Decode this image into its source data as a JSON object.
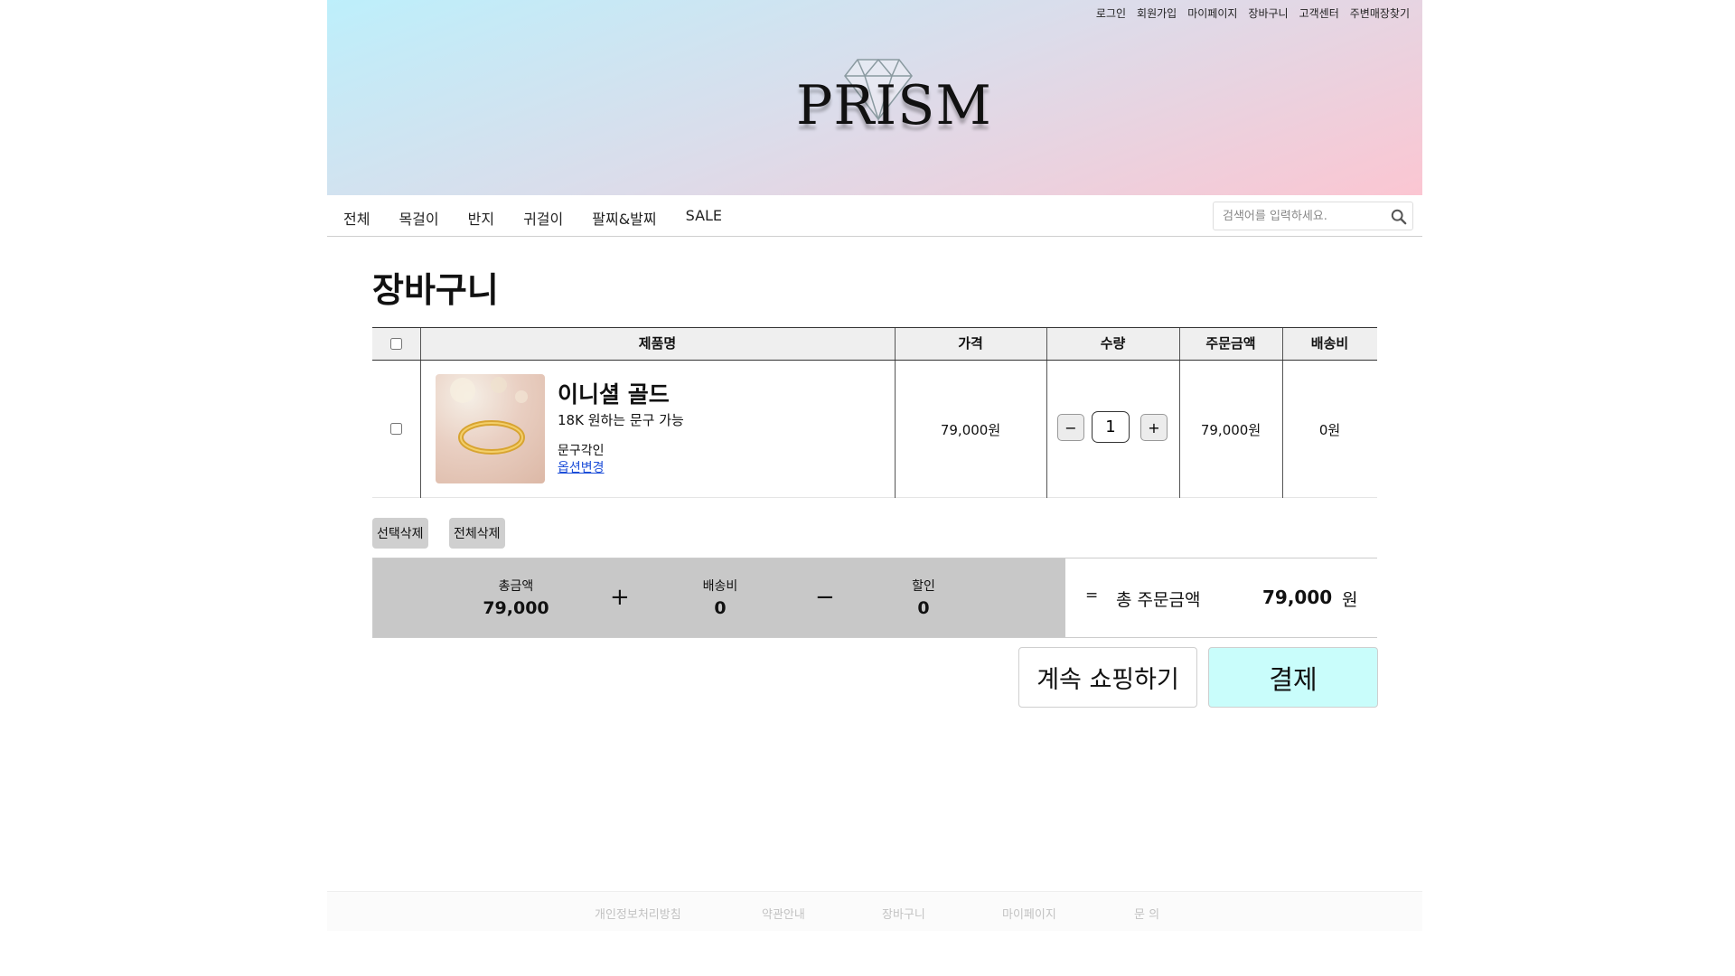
{
  "header": {
    "top_links": [
      "로그인",
      "회원가입",
      "마이페이지",
      "장바구니",
      "고객센터",
      "주변매장찾기"
    ],
    "logo_text": "PRISM"
  },
  "nav": {
    "items": [
      "전체",
      "목걸이",
      "반지",
      "귀걸이",
      "팔찌&발찌",
      "SALE"
    ],
    "search_placeholder": "검색어를 입력하세요."
  },
  "page_title": "장바구니",
  "table": {
    "columns": [
      "제품명",
      "가격",
      "수량",
      "주문금액",
      "배송비"
    ],
    "items": [
      {
        "name": "이니셜 골드",
        "description": "18K 원하는 문구 가능",
        "option": "문구각인",
        "option_change": "옵션변경",
        "price": "79,000원",
        "quantity": "1",
        "order_amount": "79,000원",
        "shipping": "0원"
      }
    ]
  },
  "buttons": {
    "delete_selected": "선택삭제",
    "delete_all": "전체삭제",
    "qty_minus": "−",
    "qty_plus": "+",
    "continue_shopping": "계속 쇼핑하기",
    "pay": "결제"
  },
  "summary": {
    "total_label": "총금액",
    "total_value": "79,000",
    "plus": "+",
    "shipping_label": "배송비",
    "shipping_value": "0",
    "minus": "−",
    "discount_label": "할인",
    "discount_value": "0",
    "equals": "=",
    "grand_label": "총 주문금액",
    "grand_value": "79,000",
    "currency": "원"
  },
  "footer": {
    "links": [
      "개인정보처리방침",
      "약관안내",
      "장바구니",
      "마이페이지",
      "문 의"
    ]
  },
  "colors": {
    "header_gradient_start": "#bdeffb",
    "header_gradient_end": "#fbc6d2",
    "pay_button": "#c9fdfb",
    "summary_bg": "#c8c8c8",
    "link_blue": "#1d4ed8"
  }
}
